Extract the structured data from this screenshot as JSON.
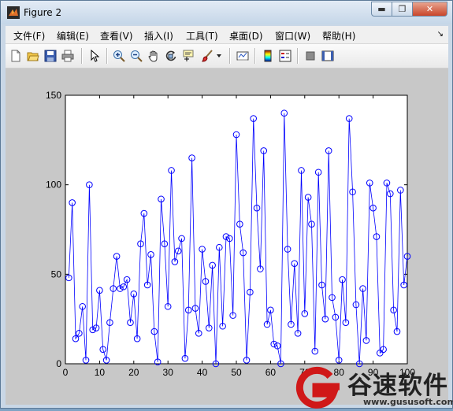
{
  "window": {
    "title": "Figure 2"
  },
  "menu": [
    {
      "label": "文件(F)"
    },
    {
      "label": "编辑(E)"
    },
    {
      "label": "查看(V)"
    },
    {
      "label": "插入(I)"
    },
    {
      "label": "工具(T)"
    },
    {
      "label": "桌面(D)"
    },
    {
      "label": "窗口(W)"
    },
    {
      "label": "帮助(H)"
    }
  ],
  "toolbar": {
    "icons": [
      "new-figure-icon",
      "open-file-icon",
      "save-icon",
      "print-icon",
      "arrow-cursor-icon",
      "zoom-in-icon",
      "zoom-out-icon",
      "pan-hand-icon",
      "rotate-3d-icon",
      "data-cursor-icon",
      "brush-icon",
      "brush-dropdown-icon",
      "link-plot-icon",
      "colorbar-icon",
      "legend-icon",
      "hide-plot-tools-icon",
      "show-plot-tools-icon"
    ]
  },
  "chart_data": {
    "type": "line",
    "marker": "circle",
    "line_color": "#0000ff",
    "xlim": [
      0,
      100
    ],
    "ylim": [
      0,
      150
    ],
    "xticks": [
      0,
      10,
      20,
      30,
      40,
      50,
      60,
      70,
      80,
      90,
      100
    ],
    "yticks": [
      0,
      50,
      100,
      150
    ],
    "xtick_labels": [
      "0",
      "10",
      "20",
      "30",
      "40",
      "50",
      "60",
      "70",
      "80",
      "90",
      "100"
    ],
    "ytick_labels": [
      "0",
      "50",
      "100",
      "150"
    ],
    "title": "",
    "xlabel": "",
    "ylabel": "",
    "grid": false,
    "series": [
      {
        "x": [
          1,
          2,
          3,
          4,
          5,
          6,
          7,
          8,
          9,
          10,
          11,
          12,
          13,
          14,
          15,
          16,
          17,
          18,
          19,
          20,
          21,
          22,
          23,
          24,
          25,
          26,
          27,
          28,
          29,
          30,
          31,
          32,
          33,
          34,
          35,
          36,
          37,
          38,
          39,
          40,
          41,
          42,
          43,
          44,
          45,
          46,
          47,
          48,
          49,
          50,
          51,
          52,
          53,
          54,
          55,
          56,
          57,
          58,
          59,
          60,
          61,
          62,
          63,
          64,
          65,
          66,
          67,
          68,
          69,
          70,
          71,
          72,
          73,
          74,
          75,
          76,
          77,
          78,
          79,
          80,
          81,
          82,
          83,
          84,
          85,
          86,
          87,
          88,
          89,
          90,
          91,
          92,
          93,
          94,
          95,
          96,
          97,
          98,
          99,
          100
        ],
        "values": [
          48,
          90,
          14,
          17,
          32,
          2,
          100,
          19,
          20,
          41,
          8,
          2,
          23,
          42,
          60,
          42,
          43,
          47,
          23,
          39,
          14,
          67,
          84,
          44,
          61,
          18,
          1,
          92,
          67,
          32,
          108,
          57,
          63,
          70,
          3,
          30,
          115,
          31,
          17,
          64,
          46,
          20,
          55,
          0,
          65,
          21,
          71,
          70,
          27,
          128,
          78,
          62,
          2,
          40,
          137,
          87,
          53,
          119,
          22,
          30,
          11,
          10,
          0,
          140,
          64,
          22,
          56,
          17,
          108,
          28,
          93,
          78,
          7,
          107,
          44,
          25,
          119,
          37,
          26,
          2,
          47,
          23,
          137,
          96,
          33,
          0,
          42,
          13,
          101,
          87,
          71,
          6,
          8,
          101,
          95,
          30,
          18,
          97,
          44,
          60
        ]
      }
    ]
  },
  "watermark": {
    "brand_cn": "谷速软件",
    "url": "www.gususoft.com"
  }
}
